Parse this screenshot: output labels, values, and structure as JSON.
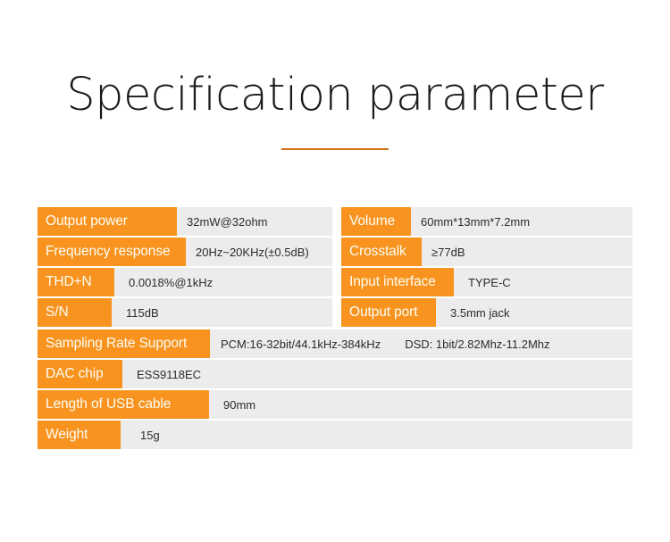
{
  "header": {
    "title": "Specification parameter",
    "accent_color": "#d2701c"
  },
  "theme": {
    "label_bg": "#f7931e",
    "label_text": "#fffdf6",
    "value_bg": "#ececec",
    "value_text": "#2b2b2b",
    "page_bg": "#ffffff"
  },
  "spec_table": {
    "paired_rows": [
      {
        "left": {
          "label": "Output power",
          "value": "32mW@32ohm",
          "label_width": 156,
          "value_pad": "normal"
        },
        "right": {
          "label": "Volume",
          "value": "60mm*13mm*7.2mm",
          "label_width": 78,
          "value_pad": "normal"
        }
      },
      {
        "left": {
          "label": "Frequency response",
          "value": "20Hz~20KHz(±0.5dB)",
          "label_width": 166,
          "value_pad": "normal"
        },
        "right": {
          "label": "Crosstalk",
          "value": "≥77dB",
          "label_width": 90,
          "value_pad": "normal"
        }
      },
      {
        "left": {
          "label": "THD+N",
          "value": "0.0018%@1kHz",
          "label_width": 86,
          "value_pad": "lg"
        },
        "right": {
          "label": "Input interface",
          "value": "TYPE-C",
          "label_width": 126,
          "value_pad": "lg"
        }
      },
      {
        "left": {
          "label": "S/N",
          "value": "115dB",
          "label_width": 83,
          "value_pad": "lg"
        },
        "right": {
          "label": "Output port",
          "value": "3.5mm jack",
          "label_width": 106,
          "value_pad": "lg"
        }
      }
    ],
    "full_rows": [
      {
        "label": "Sampling Rate Support",
        "label_width": 193,
        "value": "PCM:16-32bit/44.1kHz-384kHz",
        "value_secondary": "DSD: 1bit/2.82Mhz-11.2Mhz",
        "dual": true
      },
      {
        "label": "DAC chip",
        "label_width": 95,
        "value": "ESS9118EC",
        "value_pad": "lg"
      },
      {
        "label": "Length of USB cable",
        "label_width": 192,
        "value": "90mm",
        "value_pad": "lg"
      },
      {
        "label": "Weight",
        "label_width": 93,
        "value": "15g",
        "value_pad": "xl"
      }
    ]
  }
}
